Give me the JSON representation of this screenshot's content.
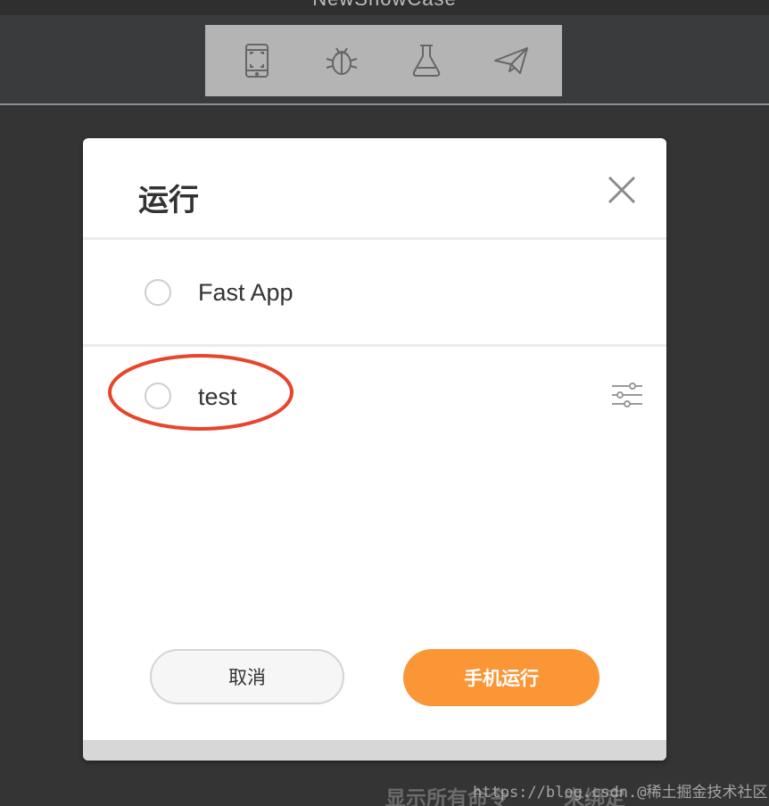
{
  "app": {
    "title": "NewShowCase"
  },
  "toolbar": {
    "items": [
      {
        "icon": "phone-scan-icon"
      },
      {
        "icon": "bug-icon"
      },
      {
        "icon": "flask-icon"
      },
      {
        "icon": "paper-plane-icon"
      }
    ]
  },
  "dialog": {
    "title": "运行",
    "options": [
      {
        "label": "Fast App",
        "selected": false
      },
      {
        "label": "test",
        "selected": false
      }
    ],
    "cancel_label": "取消",
    "run_label": "手机运行"
  },
  "background": {
    "show_all_commands": "显示所有命令",
    "unbound": "未绑定"
  },
  "watermark": "https://blog.csdn.@稀土掘金技术社区",
  "colors": {
    "accent": "#fb9637",
    "annotation": "#e8452c",
    "toolbar_bg": "#b4b4b4",
    "icon": "#666666"
  }
}
